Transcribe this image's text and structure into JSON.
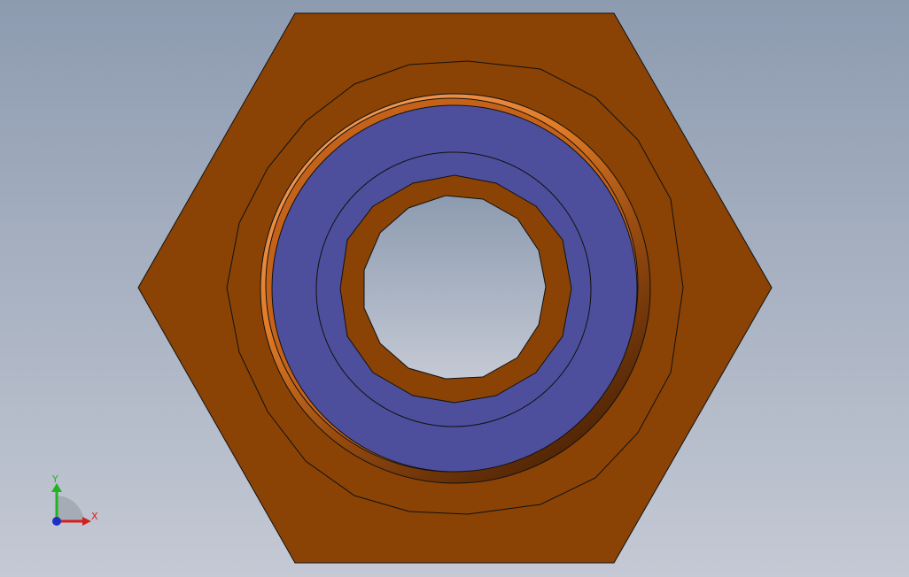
{
  "viewport": {
    "background_top": "#8d9bb0",
    "background_bottom": "#c4c9d4"
  },
  "part": {
    "hex_color": "#8a4305",
    "seal_color": "#4e4f9c",
    "rim_highlight": "#f08a35",
    "rim_shadow": "#4a2002",
    "edge_color": "#111111"
  },
  "triad": {
    "x_label": "X",
    "y_label": "Y",
    "x_color": "#d42020",
    "y_color": "#21b321",
    "z_color": "#1f2fc2"
  }
}
